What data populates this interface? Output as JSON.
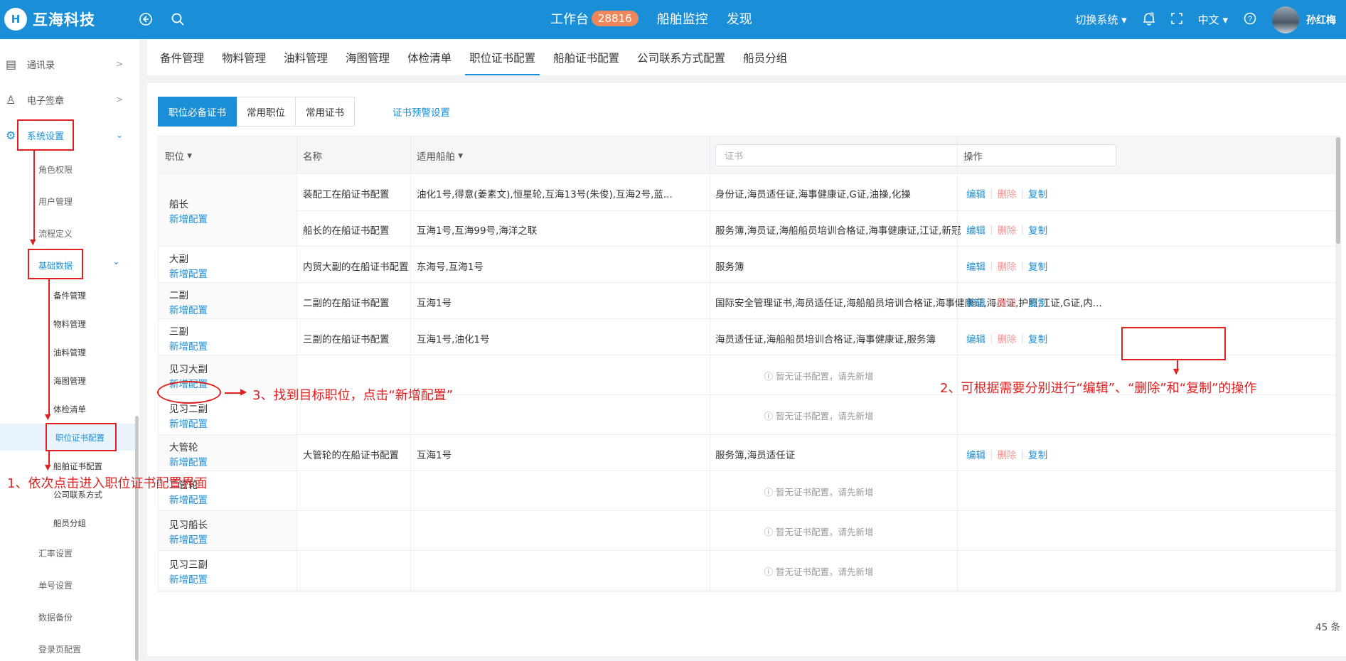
{
  "topbar": {
    "logo_mark": "H",
    "logo_text": "互海科技",
    "nav": [
      {
        "label": "工作台",
        "badge": "28816"
      },
      {
        "label": "船舶监控"
      },
      {
        "label": "发现"
      }
    ],
    "switch_system": "切换系统",
    "language": "中文",
    "user": "孙红梅"
  },
  "sidebar": {
    "top_items": [
      "通讯录",
      "电子签章",
      "系统设置"
    ],
    "level1": [
      "角色权限",
      "用户管理",
      "流程定义",
      "基础数据"
    ],
    "level2": [
      "备件管理",
      "物料管理",
      "油料管理",
      "海图管理",
      "体检清单",
      "职位证书配置",
      "船舶证书配置",
      "公司联系方式",
      "船员分组"
    ],
    "bottom": [
      "汇率设置",
      "单号设置",
      "数据备份",
      "登录页配置"
    ]
  },
  "tabs": [
    "备件管理",
    "物料管理",
    "油料管理",
    "海图管理",
    "体检清单",
    "职位证书配置",
    "船舶证书配置",
    "公司联系方式配置",
    "船员分组"
  ],
  "subtabs": [
    "职位必备证书",
    "常用职位",
    "常用证书"
  ],
  "warning_link": "证书预警设置",
  "table": {
    "headers": {
      "position": "职位",
      "name": "名称",
      "ships": "适用船舶",
      "cert_placeholder": "证书",
      "ops": "操作"
    },
    "add_label": "新增配置",
    "empty_label": "暂无证书配置，请先新增",
    "ops": {
      "edit": "编辑",
      "del": "删除",
      "copy": "复制"
    },
    "rows": [
      {
        "position": "船长",
        "configs": [
          {
            "name": "装配工在船证书配置",
            "ships": "油化1号,得意(姜素文),恒星轮,互海13号(朱俊),互海2号,蓝...",
            "certs": "身份证,海员适任证,海事健康证,G证,油操,化操"
          },
          {
            "name": "船长的在船证书配置",
            "ships": "互海1号,互海99号,海洋之联",
            "certs": "服务簿,海员证,海船船员培训合格证,海事健康证,江证,新冠"
          }
        ]
      },
      {
        "position": "大副",
        "configs": [
          {
            "name": "内贸大副的在船证书配置",
            "ships": "东海号,互海1号",
            "certs": "服务簿"
          }
        ]
      },
      {
        "position": "二副",
        "configs": [
          {
            "name": "二副的在船证书配置",
            "ships": "互海1号",
            "certs": "国际安全管理证书,海员适任证,海船船员培训合格证,海事健康证,海员证,护照,江证,G证,内..."
          }
        ]
      },
      {
        "position": "三副",
        "configs": [
          {
            "name": "三副的在船证书配置",
            "ships": "互海1号,油化1号",
            "certs": "海员适任证,海船船员培训合格证,海事健康证,服务簿"
          }
        ]
      },
      {
        "position": "见习大副",
        "configs": []
      },
      {
        "position": "见习二副",
        "configs": []
      },
      {
        "position": "大管轮",
        "configs": [
          {
            "name": "大管轮的在船证书配置",
            "ships": "互海1号",
            "certs": "服务簿,海员适任证"
          }
        ]
      },
      {
        "position": "二管轮",
        "configs": []
      },
      {
        "position": "见习船长",
        "configs": []
      },
      {
        "position": "见习三副",
        "configs": []
      }
    ],
    "total": "45 条"
  },
  "annotations": {
    "step1": "1、依次点击进入职位证书配置界面",
    "step2": "2、可根据需要分别进行“编辑”、“删除”和“复制”的操作",
    "step3": "3、找到目标职位，点击“新增配置”"
  },
  "colors": {
    "primary": "#1a8fd8",
    "danger": "#e02020",
    "badge": "#f0875a"
  }
}
